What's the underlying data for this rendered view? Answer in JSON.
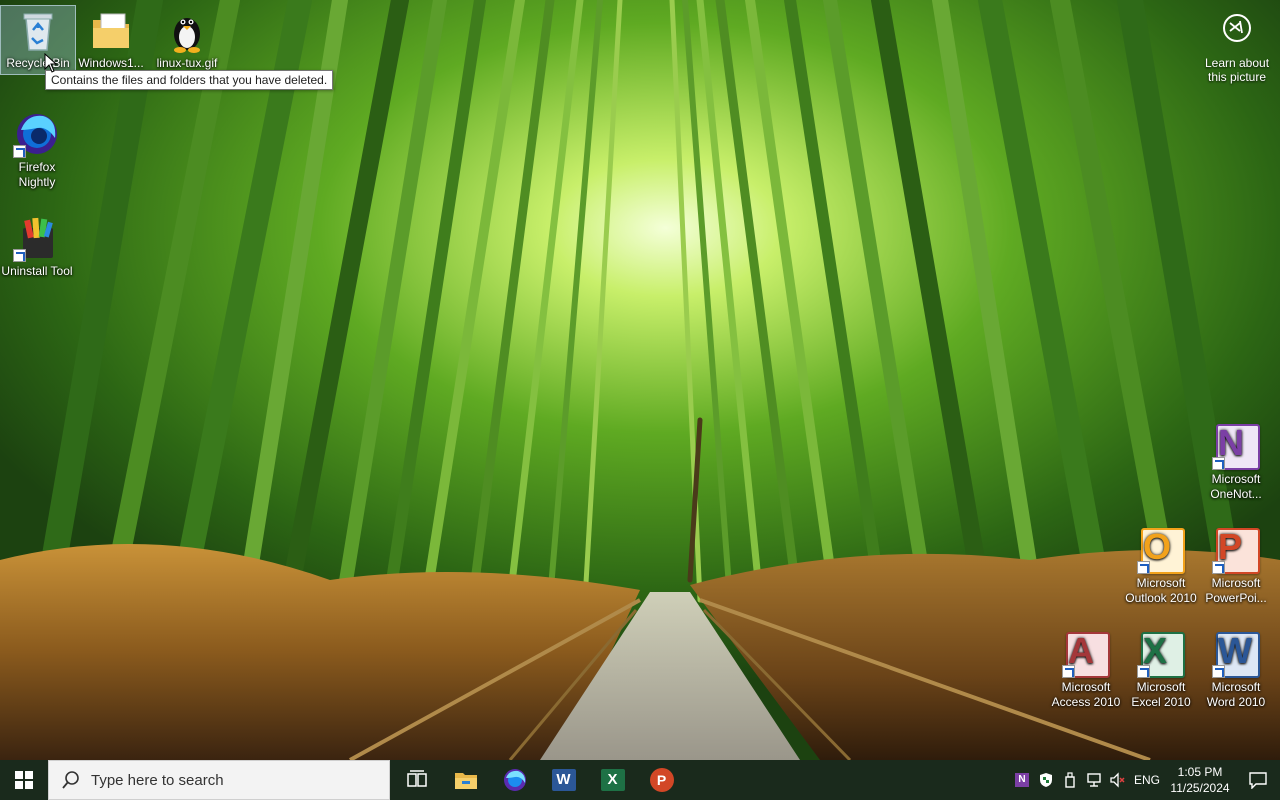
{
  "desktop": {
    "icons_left": [
      {
        "label": "Recycle Bin",
        "icon": "recycle-bin-icon"
      },
      {
        "label": "Windows1...",
        "icon": "folder-icon"
      },
      {
        "label": "linux-tux.gif",
        "icon": "penguin-icon"
      },
      {
        "label": "Firefox Nightly",
        "icon": "firefox-nightly-icon"
      },
      {
        "label": "Uninstall Tool",
        "icon": "uninstall-tool-icon"
      }
    ],
    "icons_right": [
      {
        "label": "Microsoft OneNot...",
        "icon": "onenote-icon",
        "letter": "N"
      },
      {
        "label": "Microsoft Outlook 2010",
        "icon": "outlook-icon",
        "letter": "O"
      },
      {
        "label": "Microsoft PowerPoi...",
        "icon": "powerpoint-icon",
        "letter": "P"
      },
      {
        "label": "Microsoft Access 2010",
        "icon": "access-icon",
        "letter": "A"
      },
      {
        "label": "Microsoft Excel 2010",
        "icon": "excel-icon",
        "letter": "X"
      },
      {
        "label": "Microsoft Word 2010",
        "icon": "word-icon",
        "letter": "W"
      }
    ],
    "tooltip": "Contains the files and folders that you have deleted.",
    "learn_about_picture": "Learn about this picture"
  },
  "taskbar": {
    "search_placeholder": "Type here to search",
    "pinned": [
      {
        "name": "task-view",
        "icon": "task-view-icon"
      },
      {
        "name": "file-explorer",
        "icon": "file-explorer-icon"
      },
      {
        "name": "firefox",
        "icon": "firefox-icon"
      },
      {
        "name": "word",
        "icon": "word-icon",
        "letter": "W"
      },
      {
        "name": "excel",
        "icon": "excel-icon",
        "letter": "X"
      },
      {
        "name": "powerpoint",
        "icon": "powerpoint-icon",
        "letter": "P"
      }
    ],
    "tray": {
      "language": "ENG",
      "time": "1:05 PM",
      "date": "11/25/2024"
    }
  },
  "colors": {
    "onenote": "#7b3fa5",
    "outlook": "#f2a21b",
    "powerpoint": "#d24726",
    "access": "#a4373a",
    "excel": "#1e7145",
    "word": "#2b5797",
    "taskbar": "#1a2a1c"
  }
}
